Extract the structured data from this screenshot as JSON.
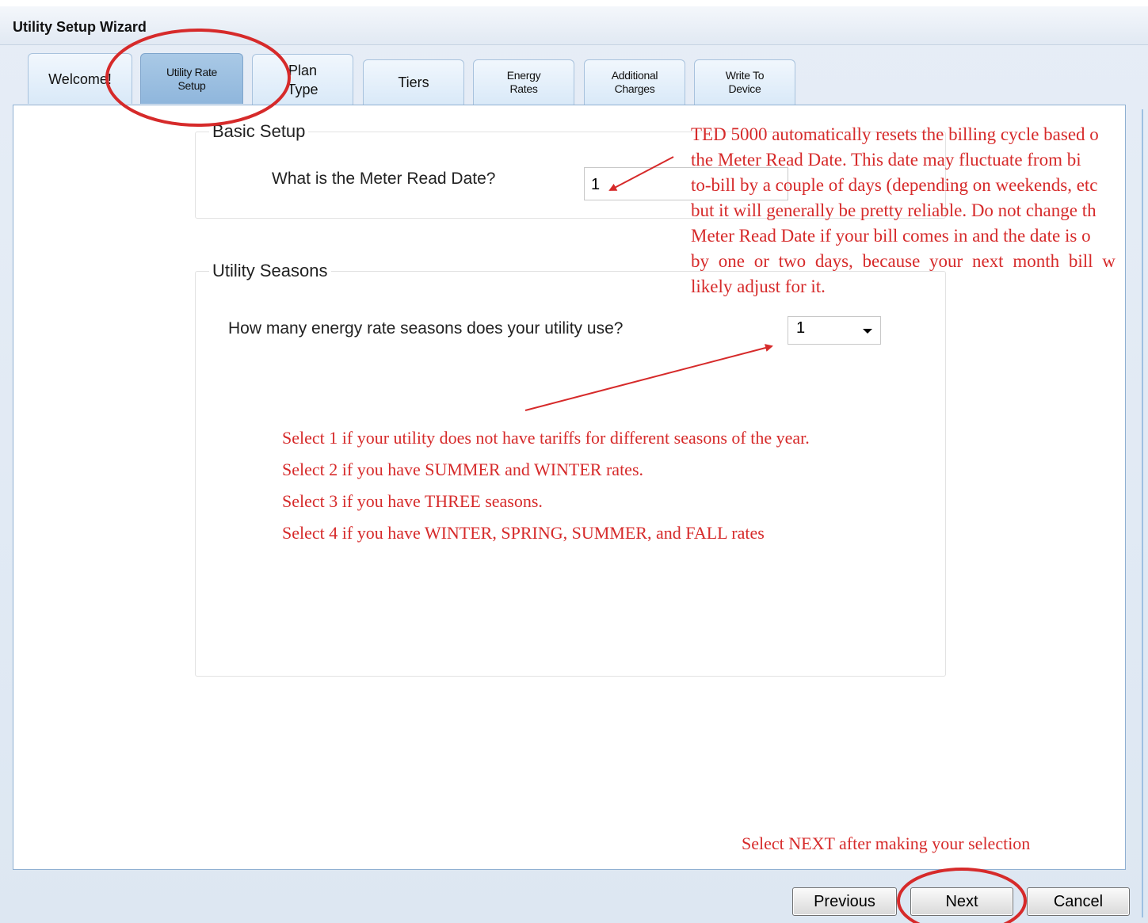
{
  "window": {
    "title": "Utility Setup Wizard"
  },
  "tabs": [
    {
      "label": "Welcome!"
    },
    {
      "label": "Utility Rate Setup",
      "line1": "Utility Rate",
      "line2": "Setup"
    },
    {
      "label": "Plan Type",
      "line1": "Plan",
      "line2": "Type"
    },
    {
      "label": "Tiers"
    },
    {
      "label": "Energy Rates",
      "line1": "Energy",
      "line2": "Rates"
    },
    {
      "label": "Additional Charges",
      "line1": "Additional",
      "line2": "Charges"
    },
    {
      "label": "Write To Device",
      "line1": "Write To",
      "line2": "Device"
    }
  ],
  "basic_setup": {
    "group_label": "Basic Setup",
    "meter_read_label": "What is the Meter Read Date?",
    "meter_read_value": "1"
  },
  "utility_seasons": {
    "group_label": "Utility Seasons",
    "seasons_label": "How many energy rate seasons does your utility use?",
    "seasons_value": "1"
  },
  "annotations": {
    "meter_note_lines": [
      "TED 5000 automatically resets the billing cycle based o",
      "the Meter Read Date.  This date may fluctuate from bi",
      "to-bill by a couple of days (depending on weekends, etc",
      "but it will generally be pretty reliable.  Do not change th",
      "Meter Read Date if your bill comes in and the date is o",
      "by one or two days, because your next month bill w",
      "likely adjust for it."
    ],
    "season_note_lines": [
      "Select 1 if your utility does not have tariffs for different seasons of the year.",
      "Select 2 if you have SUMMER and WINTER rates.",
      "Select 3 if you have THREE seasons.",
      "Select 4 if you have WINTER, SPRING, SUMMER, and FALL rates"
    ],
    "next_note": "Select NEXT after making your selection",
    "color": "#d62a2a"
  },
  "buttons": {
    "previous": "Previous",
    "next": "Next",
    "cancel": "Cancel"
  }
}
